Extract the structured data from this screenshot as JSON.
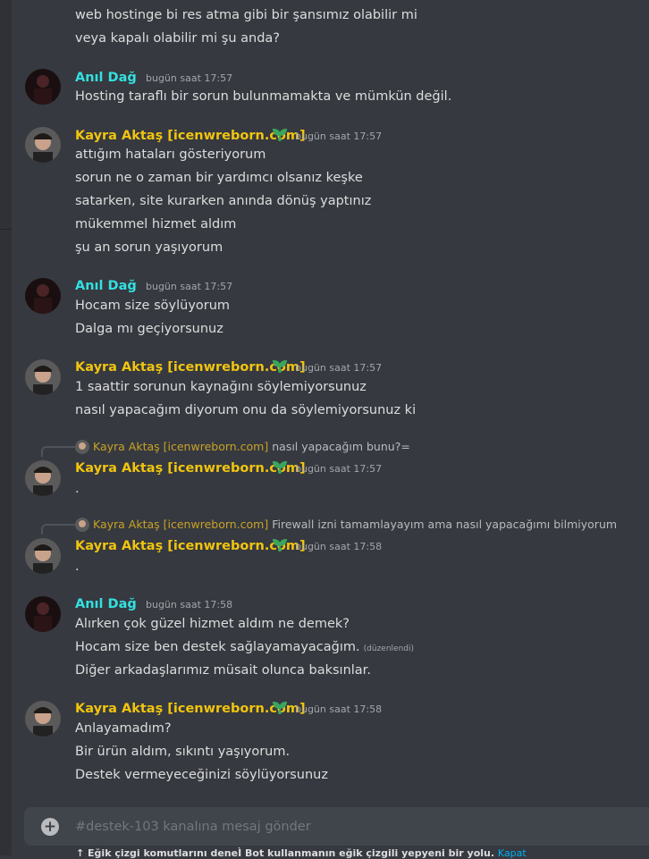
{
  "messages": {
    "top": {
      "line1": "web hostinge bi res atma gibi bir şansımız olabilir mi",
      "line2": "veya kapalı olabilir mi şu anda?"
    },
    "m1": {
      "author": "Anıl Dağ",
      "time": "bugün saat 17:57",
      "lines": [
        "Hosting taraflı bir sorun bulunmamakta ve mümkün değil."
      ]
    },
    "m2": {
      "author": "Kayra Aktaş [icenwreborn.com]",
      "time": "bugün saat 17:57",
      "lines": [
        "attığım hataları gösteriyorum",
        "sorun ne o zaman bir yardımcı olsanız keşke",
        "satarken, site kurarken anında dönüş yaptınız",
        "mükemmel hizmet aldım",
        "şu an sorun yaşıyorum"
      ]
    },
    "m3": {
      "author": "Anıl Dağ",
      "time": "bugün saat 17:57",
      "lines": [
        "Hocam size söylüyorum",
        "Dalga mı geçiyorsunuz"
      ]
    },
    "m4": {
      "author": "Kayra Aktaş [icenwreborn.com]",
      "time": "bugün saat 17:57",
      "lines": [
        "1 saattir sorunun kaynağını söylemiyorsunuz",
        "nasıl yapacağım diyorum onu da söylemiyorsunuz ki"
      ]
    },
    "m5": {
      "reply_author": "Kayra Aktaş [icenwreborn.com]",
      "reply_text": "nasıl yapacağım bunu?=",
      "author": "Kayra Aktaş [icenwreborn.com]",
      "time": "bugün saat 17:57",
      "lines": [
        "."
      ]
    },
    "m6": {
      "reply_author": "Kayra Aktaş [icenwreborn.com]",
      "reply_text": "Firewall izni tamamlayayım ama nasıl yapacağımı bilmiyorum",
      "author": "Kayra Aktaş [icenwreborn.com]",
      "time": "bugün saat 17:58",
      "lines": [
        "."
      ]
    },
    "m7": {
      "author": "Anıl Dağ",
      "time": "bugün saat 17:58",
      "lines": [
        "Alırken çok güzel hizmet aldım ne demek?",
        "Hocam size ben destek sağlayamayacağım.",
        "Diğer arkadaşlarımız müsait olunca baksınlar."
      ],
      "edited": "(düzenlendi)"
    },
    "m8": {
      "author": "Kayra Aktaş [icenwreborn.com]",
      "time": "bugün saat 17:58",
      "lines": [
        "Anlayamadım?",
        "Bir ürün aldım, sıkıntı yaşıyorum.",
        "Destek vermeyeceğinizi söylüyorsunuz"
      ]
    }
  },
  "composer": {
    "placeholder": "#destek-103 kanalına mesaj gönder",
    "plus_icon": "plus-circle-icon"
  },
  "footer": {
    "text": "Eğik çizgi komutlarını deneÌ Bot kullanmanın eğik çizgili yepyeni bir yolu.",
    "link": "Kapat"
  },
  "colors": {
    "background": "#36393f",
    "anil_name": "#33e0e0",
    "kayra_name": "#f1c40f",
    "leaf_badge": "#3ba55d"
  }
}
